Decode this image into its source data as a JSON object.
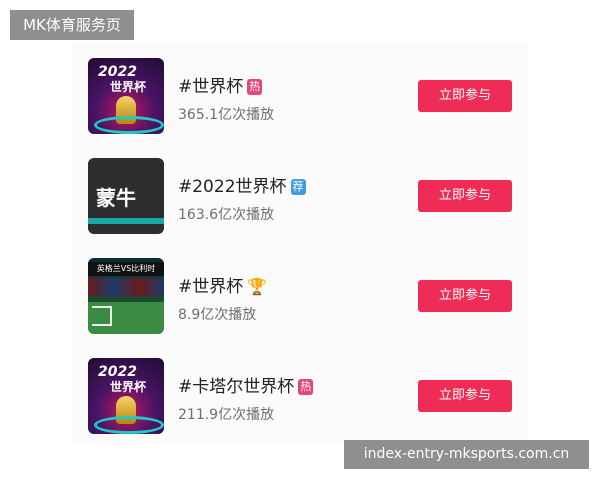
{
  "watermark_top": "MK体育服务页",
  "watermark_bottom": "index-entry-mksports.com.cn",
  "colors": {
    "hot": "#e8447a",
    "rec": "#3e9ce0",
    "button": "#ef2c55"
  },
  "topics": [
    {
      "title": "#世界杯",
      "badge": "热",
      "badge_kind": "hot",
      "views": "365.1亿次播放",
      "button": "立即参与",
      "thumb": {
        "year": "2022",
        "text": "世界杯"
      }
    },
    {
      "title": "#2022世界杯",
      "badge": "荐",
      "badge_kind": "rec",
      "views": "163.6亿次播放",
      "button": "立即参与",
      "thumb": {
        "text": "蒙牛"
      }
    },
    {
      "title": "#世界杯",
      "badge_icon": "trophy-icon",
      "views": "8.9亿次播放",
      "button": "立即参与",
      "thumb": {
        "text": "英格兰VS比利时"
      }
    },
    {
      "title": "#卡塔尔世界杯",
      "badge": "热",
      "badge_kind": "hot",
      "views": "211.9亿次播放",
      "button": "立即参与",
      "thumb": {
        "year": "2022",
        "text": "世界杯"
      }
    }
  ]
}
